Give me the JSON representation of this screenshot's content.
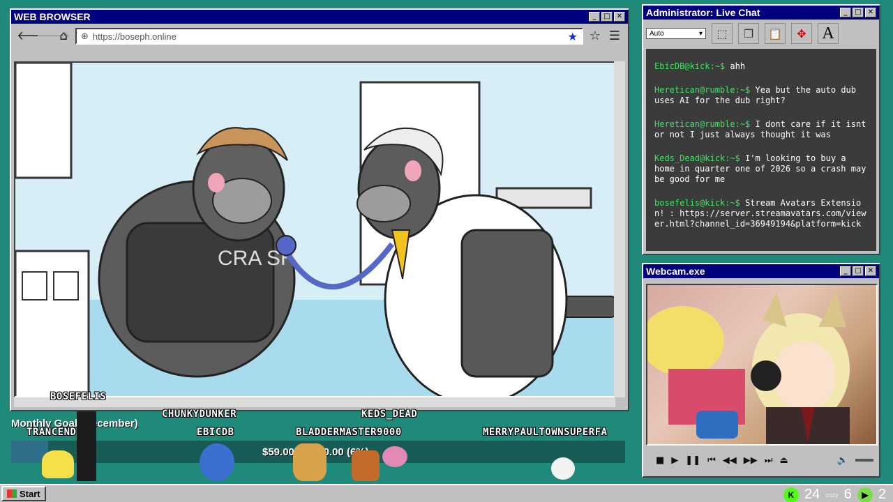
{
  "browser": {
    "title": "WEB BROWSER",
    "url": "https://boseph.online",
    "back_icon": "arrow-left-icon",
    "forward_icon": "arrow-right-icon",
    "home_icon": "home-icon"
  },
  "video": {
    "sweater_text": "CRA SH"
  },
  "chat": {
    "title": "Administrator: Live Chat",
    "select_value": "Auto",
    "messages": [
      {
        "user": "EbicDB@kick:~$",
        "text": "ahh"
      },
      {
        "user": "Heretican@rumble:~$",
        "text": "Yea but the auto dub uses AI for the dub right?"
      },
      {
        "user": "Heretican@rumble:~$",
        "text": "I dont care if it isnt or not I just always thought it was"
      },
      {
        "user": "Keds_Dead@kick:~$",
        "text": "I'm looking to buy a home in quarter one of 2026 so a crash may be good for me"
      },
      {
        "user": "bosefelis@kick:~$",
        "text": "Stream Avatars Extension! : https://server.streamavatars.com/viewer.html?channel_id=36949194&platform=kick"
      }
    ]
  },
  "webcam": {
    "title": "Webcam.exe"
  },
  "overlay": {
    "goal_title": "Monthly Goal (December)",
    "goal_text": "$59.00/$1,000.00 (6%)",
    "goal_fraction": 0.06,
    "names": [
      "BOSEFELIS",
      "CHUNKYDUNKER",
      "KEDS_DEAD",
      "TRANCEND",
      "EBICDB",
      "BLADDERMASTER9000",
      "MERRYPAULTOWNSUPERFA"
    ]
  },
  "taskbar": {
    "start_label": "Start",
    "stat1": "24",
    "stat2": "6",
    "stat3": "2",
    "cozy": "cozy"
  },
  "colors": {
    "desktop": "#1f8a7a",
    "titlebar": "#00007e",
    "chat_user": "#39e75f",
    "kick_green": "#53fc18"
  }
}
